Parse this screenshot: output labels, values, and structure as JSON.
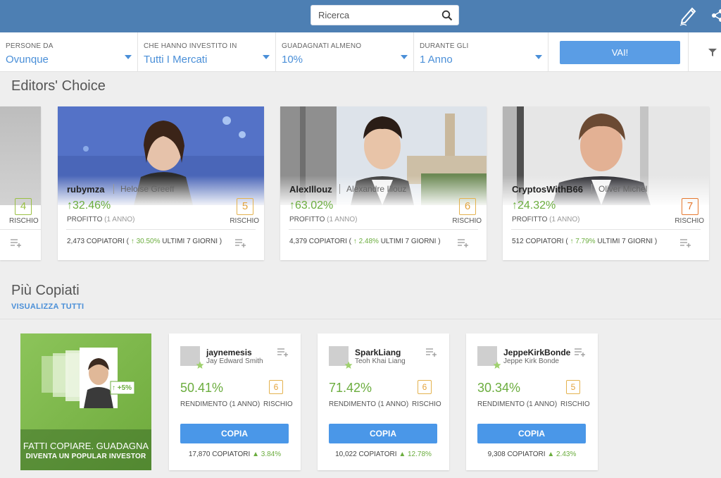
{
  "header": {
    "search_placeholder": "Ricerca"
  },
  "filters": [
    {
      "label": "PERSONE DA",
      "value": "Ovunque"
    },
    {
      "label": "CHE HANNO INVESTITO IN",
      "value": "Tutti I Mercati"
    },
    {
      "label": "GUADAGNATI ALMENO",
      "value": "10%"
    },
    {
      "label": "DURANTE GLI",
      "value": "1 Anno"
    }
  ],
  "go_button": "VAI!",
  "editors_choice": {
    "title": "Editors' Choice",
    "partial_card": {
      "risk": "4",
      "risk_label": "RISCHIO"
    },
    "cards": [
      {
        "username": "rubymza",
        "fullname": "Heloise Greeff",
        "gain": "32.46%",
        "profit_label": "PROFITTO",
        "period": "(1 ANNO)",
        "risk": "5",
        "risk_label": "RISCHIO",
        "copiers": "2,473 COPIATORI (",
        "change": "30.50%",
        "change_suffix": "ULTIMI 7 GIORNI )",
        "risk_color": "#e4a43e"
      },
      {
        "username": "AlexIllouz",
        "fullname": "Alexandre Illouz",
        "gain": "63.02%",
        "profit_label": "PROFITTO",
        "period": "(1 ANNO)",
        "risk": "6",
        "risk_label": "RISCHIO",
        "copiers": "4,379 COPIATORI (",
        "change": "2.48%",
        "change_suffix": "ULTIMI 7 GIORNI )",
        "risk_color": "#e4a43e"
      },
      {
        "username": "CryptosWithB66",
        "fullname": "Oliver Michel",
        "gain": "24.32%",
        "profit_label": "PROFITTO",
        "period": "(1 ANNO)",
        "risk": "7",
        "risk_label": "RISCHIO",
        "copiers": "512 COPIATORI (",
        "change": "7.79%",
        "change_suffix": "ULTIMI 7 GIORNI )",
        "risk_color": "#e6782e"
      }
    ]
  },
  "most_copied": {
    "title": "Più Copiati",
    "view_all": "VISUALIZZA TUTTI",
    "promo": {
      "line1": "FATTI COPIARE. GUADAGNA",
      "line2": "DIVENTA UN POPULAR INVESTOR",
      "badge": "+5%"
    },
    "cards": [
      {
        "username": "jaynemesis",
        "fullname": "Jay Edward Smith",
        "gain": "50.41%",
        "gain_label": "RENDIMENTO (1 ANNO)",
        "risk": "6",
        "risk_label": "RISCHIO",
        "button": "COPIA",
        "copiers": "17,870 COPIATORI",
        "change": "3.84%"
      },
      {
        "username": "SparkLiang",
        "fullname": "Teoh Khai Liang",
        "gain": "71.42%",
        "gain_label": "RENDIMENTO (1 ANNO)",
        "risk": "6",
        "risk_label": "RISCHIO",
        "button": "COPIA",
        "copiers": "10,022 COPIATORI",
        "change": "12.78%"
      },
      {
        "username": "JeppeKirkBonde",
        "fullname": "Jeppe Kirk Bonde",
        "gain": "30.34%",
        "gain_label": "RENDIMENTO (1 ANNO)",
        "risk": "5",
        "risk_label": "RISCHIO",
        "button": "COPIA",
        "copiers": "9,308 COPIATORI",
        "change": "2.43%"
      }
    ]
  },
  "colors": {
    "header_bg": "#4d7fb3",
    "accent_blue": "#4a8fd8",
    "gain_green": "#6bad3e",
    "risk_orange": "#e4a43e"
  },
  "icons": [
    "search-icon",
    "pencil-icon",
    "share-icon",
    "funnel-icon",
    "add-to-list-icon",
    "arrow-up-icon",
    "star-icon",
    "caret-down-icon"
  ]
}
